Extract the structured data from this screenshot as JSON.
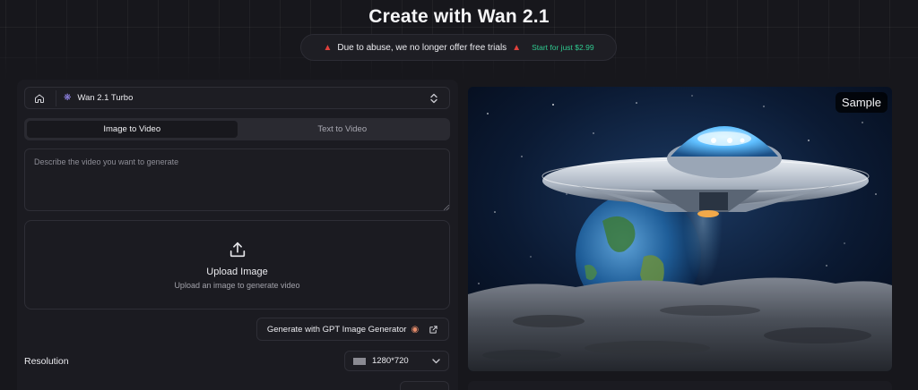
{
  "header": {
    "title": "Create with Wan 2.1",
    "notice": {
      "message": "Due to abuse, we no longer offer free trials",
      "cta": "Start for just $2.99",
      "icon": "alarm-icon"
    }
  },
  "model": {
    "name": "Wan 2.1 Turbo"
  },
  "tabs": [
    {
      "label": "Image to Video",
      "active": true
    },
    {
      "label": "Text to Video",
      "active": false
    }
  ],
  "prompt": {
    "placeholder": "Describe the video you want to generate"
  },
  "upload": {
    "title": "Upload Image",
    "subtitle": "Upload an image to generate video"
  },
  "generator_button": {
    "label": "Generate with GPT Image Generator"
  },
  "settings": {
    "resolution_label": "Resolution",
    "resolution_value": "1280*720"
  },
  "sample": {
    "badge": "Sample"
  },
  "colors": {
    "background": "#17171c",
    "panel": "#1b1b21",
    "accent_green": "#2fc98f",
    "alarm_red": "#e0413c"
  }
}
